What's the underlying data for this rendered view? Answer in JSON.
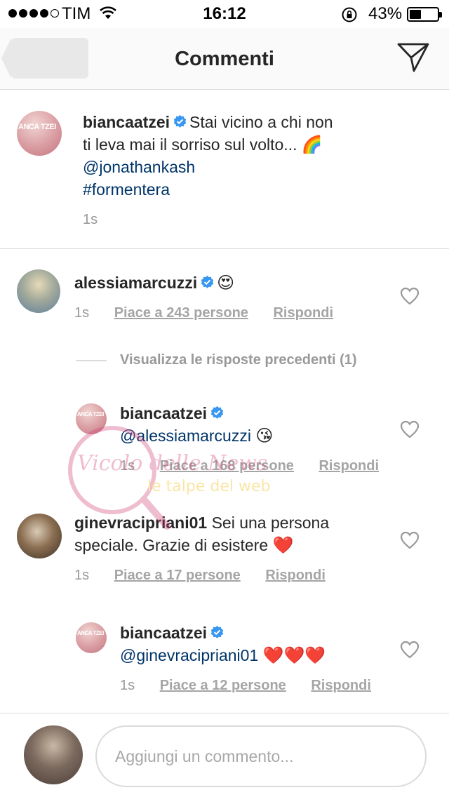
{
  "status_bar": {
    "carrier": "TIM",
    "time": "16:12",
    "battery_percent": "43%",
    "battery_level": 0.43,
    "signal_bars_filled": 4,
    "signal_bars_total": 5
  },
  "header": {
    "title": "Commenti",
    "back_icon": "back-arrow-icon",
    "send_icon": "paper-plane-icon"
  },
  "caption": {
    "username": "biancaatzei",
    "text_line1": "Stai vicino a chi non",
    "text_line2": "ti leva mai il sorriso sul volto...",
    "emoji": "🌈",
    "mention": "@jonathankash",
    "hashtag": "#formentera",
    "time": "1s"
  },
  "comments": [
    {
      "username": "alessiamarcuzzi",
      "emoji": "😍",
      "time": "1s",
      "likes": "Piace a 243 persone",
      "reply": "Rispondi"
    },
    {
      "view_replies": "Visualizza le risposte precedenti (1)"
    },
    {
      "username": "biancaatzei",
      "mention": "@alessiamarcuzzi",
      "emoji": "😘",
      "time": "1s",
      "likes": "Piace a 168 persone",
      "reply": "Rispondi"
    },
    {
      "username": "ginevracipriani01",
      "text_line1": "Sei una persona",
      "text_line2": "speciale. Grazie di esistere",
      "emoji": "❤️",
      "time": "1s",
      "likes": "Piace a 17 persone",
      "reply": "Rispondi"
    },
    {
      "username": "biancaatzei",
      "mention": "@ginevracipriani01",
      "emoji": "❤️❤️❤️",
      "time": "1s",
      "likes": "Piace a 12 persone",
      "reply": "Rispondi"
    }
  ],
  "avatar_labels": {
    "bianca": "ANCA TZEI"
  },
  "watermark": {
    "text1": "Vicolo delle News",
    "text2": "le talpe del web"
  },
  "compose": {
    "placeholder": "Aggiungi un commento..."
  },
  "colors": {
    "link": "#003569",
    "verified": "#3897f0",
    "meta": "#999999",
    "separator": "#dbdbdb"
  }
}
